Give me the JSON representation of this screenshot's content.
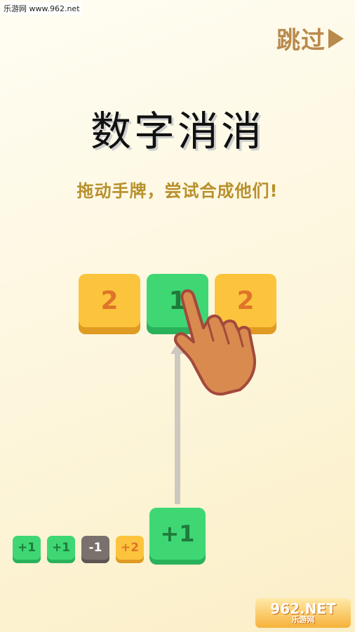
{
  "watermark_top": "乐游网 www.962.net",
  "skip": {
    "label": "跳过"
  },
  "title": "数字消消",
  "subtitle": "拖动手牌，尝试合成他们!",
  "board": {
    "tiles": [
      {
        "value": "2",
        "color": "yellow"
      },
      {
        "value": "1",
        "color": "green"
      },
      {
        "value": "2",
        "color": "yellow"
      }
    ]
  },
  "hand_cards": [
    {
      "value": "+1",
      "color": "green"
    },
    {
      "value": "+1",
      "color": "green"
    },
    {
      "value": "-1",
      "color": "gray"
    },
    {
      "value": "+2",
      "color": "orange"
    }
  ],
  "active_card": {
    "value": "+1"
  },
  "watermark_bottom": {
    "line1": "962.NET",
    "line2": "乐游网"
  },
  "colors": {
    "yellow_tile": "#fcc43d",
    "green_tile": "#3ed774",
    "gray_tile": "#7a716c",
    "skip": "#b98a4c",
    "subtitle": "#b8902c",
    "hand": "#d98a4f"
  },
  "icons": {
    "skip_arrow": "play-triangle-icon",
    "hand": "pointing-hand-icon"
  }
}
